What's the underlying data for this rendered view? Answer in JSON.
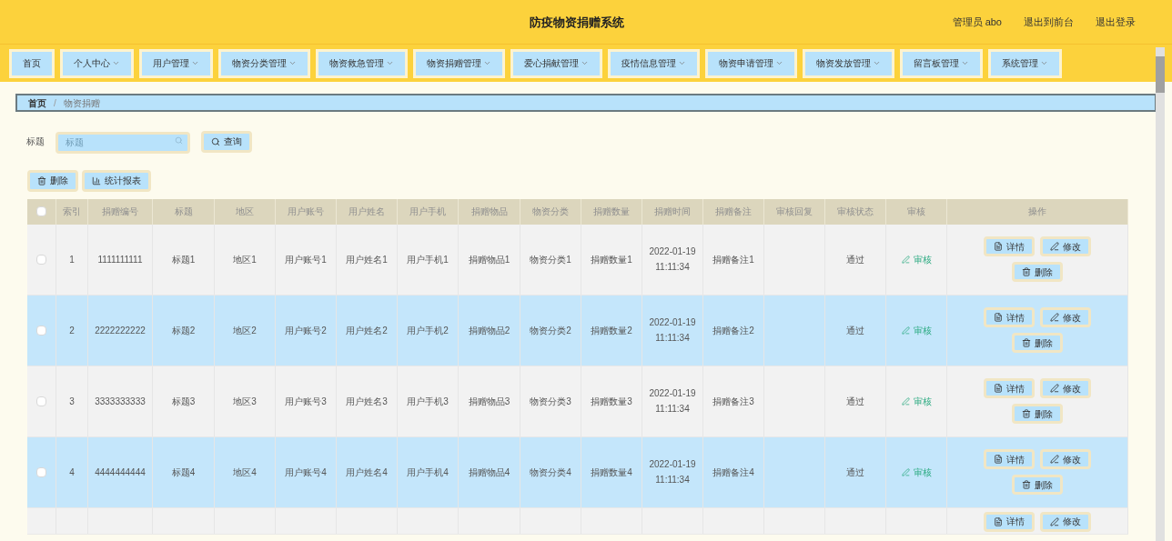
{
  "header": {
    "title": "防疫物资捐赠系统",
    "user": "管理员 abo",
    "links": [
      "退出到前台",
      "退出登录"
    ]
  },
  "nav": [
    {
      "label": "首页",
      "dropdown": false
    },
    {
      "label": "个人中心",
      "dropdown": true
    },
    {
      "label": "用户管理",
      "dropdown": true
    },
    {
      "label": "物资分类管理",
      "dropdown": true
    },
    {
      "label": "物资救急管理",
      "dropdown": true
    },
    {
      "label": "物资捐赠管理",
      "dropdown": true
    },
    {
      "label": "爱心捐献管理",
      "dropdown": true
    },
    {
      "label": "疫情信息管理",
      "dropdown": true
    },
    {
      "label": "物资申请管理",
      "dropdown": true
    },
    {
      "label": "物资发放管理",
      "dropdown": true
    },
    {
      "label": "留言板管理",
      "dropdown": true
    },
    {
      "label": "系统管理",
      "dropdown": true
    }
  ],
  "breadcrumb": {
    "separator": "/",
    "items": [
      "首页",
      "物资捐赠"
    ]
  },
  "search": {
    "label": "标题",
    "placeholder": "标题",
    "button": "查询"
  },
  "toolbar": [
    {
      "kind": "delete",
      "label": "删除"
    },
    {
      "kind": "report",
      "label": "统计报表"
    }
  ],
  "table": {
    "select_all_checked": false,
    "columns": [
      "索引",
      "捐赠编号",
      "标题",
      "地区",
      "用户账号",
      "用户姓名",
      "用户手机",
      "捐赠物品",
      "物资分类",
      "捐赠数量",
      "捐赠时间",
      "捐赠备注",
      "审核回复",
      "审核状态",
      "审核",
      "操作"
    ],
    "rows": [
      {
        "checked": false,
        "cells": [
          "1",
          "1111111111",
          "标题1",
          "地区1",
          "用户账号1",
          "用户姓名1",
          "用户手机1",
          "捐赠物品1",
          "物资分类1",
          "捐赠数量1",
          "2022-01-19 11:11:34",
          "捐赠备注1",
          "",
          "通过"
        ],
        "review": "审核",
        "actions": [
          "详情",
          "修改",
          "删除"
        ]
      },
      {
        "checked": false,
        "cells": [
          "2",
          "2222222222",
          "标题2",
          "地区2",
          "用户账号2",
          "用户姓名2",
          "用户手机2",
          "捐赠物品2",
          "物资分类2",
          "捐赠数量2",
          "2022-01-19 11:11:34",
          "捐赠备注2",
          "",
          "通过"
        ],
        "review": "审核",
        "actions": [
          "详情",
          "修改",
          "删除"
        ]
      },
      {
        "checked": false,
        "cells": [
          "3",
          "3333333333",
          "标题3",
          "地区3",
          "用户账号3",
          "用户姓名3",
          "用户手机3",
          "捐赠物品3",
          "物资分类3",
          "捐赠数量3",
          "2022-01-19 11:11:34",
          "捐赠备注3",
          "",
          "通过"
        ],
        "review": "审核",
        "actions": [
          "详情",
          "修改",
          "删除"
        ]
      },
      {
        "checked": false,
        "cells": [
          "4",
          "4444444444",
          "标题4",
          "地区4",
          "用户账号4",
          "用户姓名4",
          "用户手机4",
          "捐赠物品4",
          "物资分类4",
          "捐赠数量4",
          "2022-01-19 11:11:34",
          "捐赠备注4",
          "",
          "通过"
        ],
        "review": "审核",
        "actions": [
          "详情",
          "修改",
          "删除"
        ]
      },
      {
        "cells": [],
        "review": "",
        "actions": [
          "详情",
          "修改"
        ]
      }
    ]
  }
}
